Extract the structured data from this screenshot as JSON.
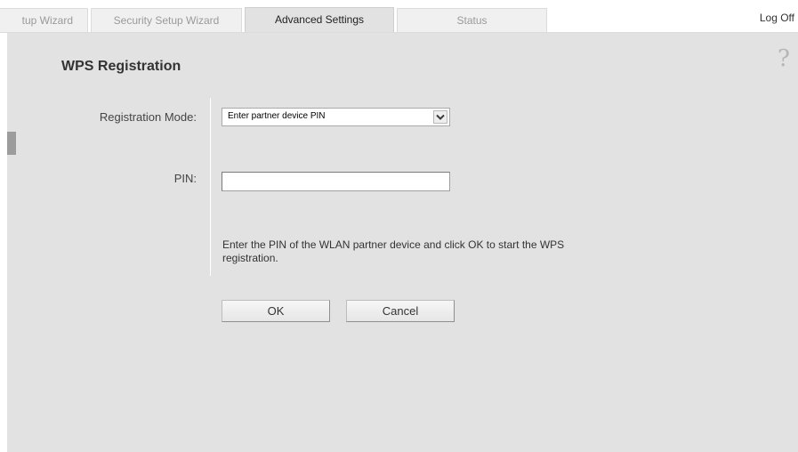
{
  "tabs": [
    {
      "label": "tup Wizard"
    },
    {
      "label": "Security Setup Wizard"
    },
    {
      "label": "Advanced Settings"
    },
    {
      "label": "Status"
    }
  ],
  "active_tab": "Advanced Settings",
  "header": {
    "logoff_label": "Log Off",
    "help_glyph": "?"
  },
  "page": {
    "title": "WPS Registration"
  },
  "form": {
    "mode_label": "Registration Mode:",
    "mode_selected": "Enter partner device PIN",
    "pin_label": "PIN:",
    "pin_value": "",
    "help_text": "Enter the PIN of the WLAN partner device and click OK to start the WPS registration.",
    "ok_label": "OK",
    "cancel_label": "Cancel"
  },
  "icons": {
    "help": "help-icon",
    "dropdown": "chevron-down-icon"
  },
  "colors": {
    "panel_bg": "#e2e2e2",
    "active_tab_bg": "#e2e2e2",
    "inactive_tab_bg": "#f0f0f0",
    "marker": "#9c9c9c"
  }
}
